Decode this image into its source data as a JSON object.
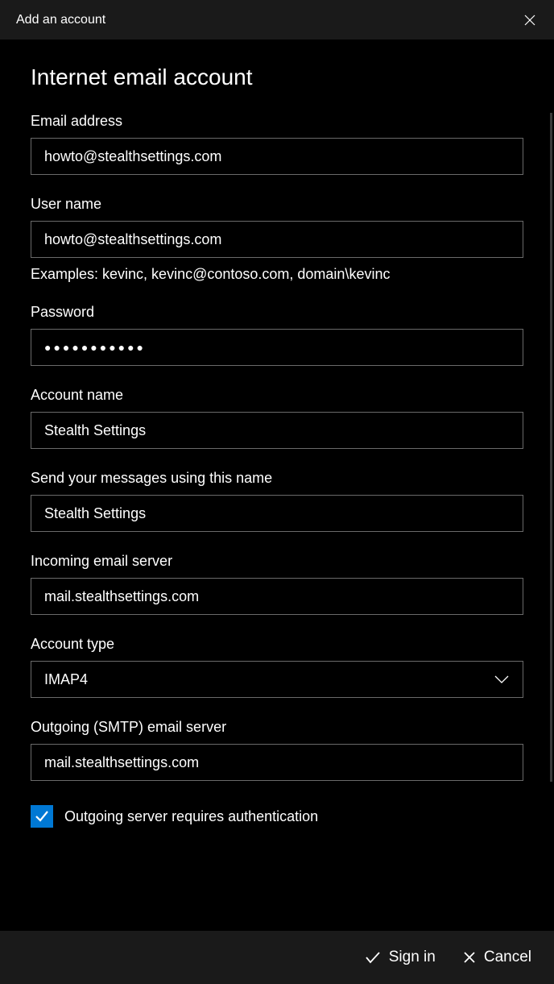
{
  "titlebar": {
    "title": "Add an account"
  },
  "heading": "Internet email account",
  "fields": {
    "email": {
      "label": "Email address",
      "value": "howto@stealthsettings.com"
    },
    "username": {
      "label": "User name",
      "value": "howto@stealthsettings.com",
      "helper": "Examples: kevinc, kevinc@contoso.com, domain\\kevinc"
    },
    "password": {
      "label": "Password",
      "value": "●●●●●●●●●●●"
    },
    "account_name": {
      "label": "Account name",
      "value": "Stealth Settings"
    },
    "send_name": {
      "label": "Send your messages using this name",
      "value": "Stealth Settings"
    },
    "incoming_server": {
      "label": "Incoming email server",
      "value": "mail.stealthsettings.com"
    },
    "account_type": {
      "label": "Account type",
      "value": "IMAP4"
    },
    "outgoing_server": {
      "label": "Outgoing (SMTP) email server",
      "value": "mail.stealthsettings.com"
    }
  },
  "checkbox": {
    "outgoing_auth": {
      "label": "Outgoing server requires authentication",
      "checked": true
    }
  },
  "footer": {
    "signin": "Sign in",
    "cancel": "Cancel"
  }
}
